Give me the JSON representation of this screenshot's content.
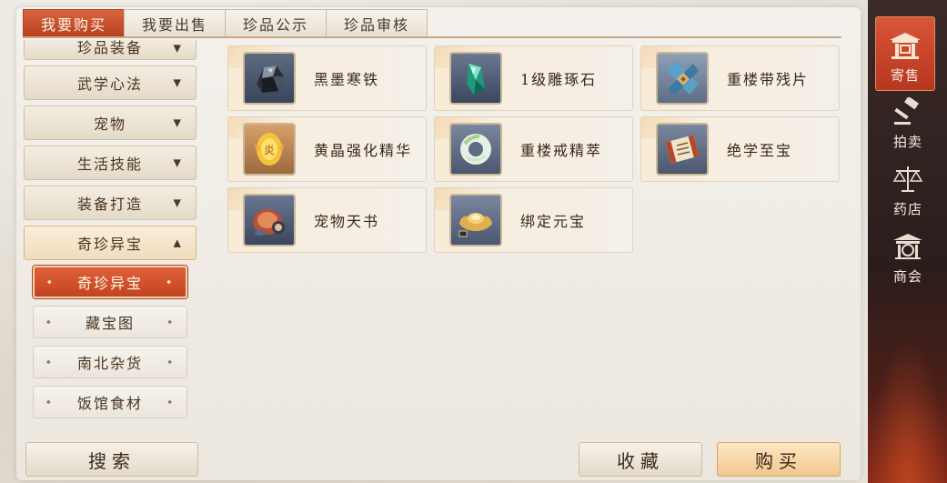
{
  "tabs": [
    {
      "label": "我要购买",
      "active": true
    },
    {
      "label": "我要出售",
      "active": false
    },
    {
      "label": "珍品公示",
      "active": false
    },
    {
      "label": "珍品审核",
      "active": false
    }
  ],
  "sidebar": {
    "categories": [
      {
        "label": "珍品装备",
        "partial": true
      },
      {
        "label": "武学心法"
      },
      {
        "label": "宠物"
      },
      {
        "label": "生活技能"
      },
      {
        "label": "装备打造"
      },
      {
        "label": "奇珍异宝",
        "open": true
      }
    ],
    "subcategories": [
      {
        "label": "奇珍异宝",
        "active": true
      },
      {
        "label": "藏宝图"
      },
      {
        "label": "南北杂货"
      },
      {
        "label": "饭馆食材"
      }
    ],
    "search_label": "搜索"
  },
  "items": [
    {
      "name": "黑墨寒铁",
      "icon": "black-iron-ore-icon"
    },
    {
      "name": "1级雕琢石",
      "icon": "green-crystal-icon"
    },
    {
      "name": "重楼带残片",
      "icon": "belt-fragment-icon"
    },
    {
      "name": "黄晶强化精华",
      "icon": "golden-essence-icon"
    },
    {
      "name": "重楼戒精萃",
      "icon": "jade-ring-icon"
    },
    {
      "name": "绝学至宝",
      "icon": "scroll-icon"
    },
    {
      "name": "宠物天书",
      "icon": "pet-book-icon"
    },
    {
      "name": "绑定元宝",
      "icon": "gold-ingot-icon"
    }
  ],
  "actions": {
    "favorite_label": "收藏",
    "buy_label": "购买"
  },
  "rightnav": [
    {
      "label": "寄售",
      "icon": "pavilion-icon",
      "active": true
    },
    {
      "label": "拍卖",
      "icon": "gavel-icon"
    },
    {
      "label": "药店",
      "icon": "scales-icon"
    },
    {
      "label": "商会",
      "icon": "guild-hall-icon"
    }
  ],
  "colors": {
    "accent": "#c8482a",
    "buy": "#f1c88f",
    "nav_bg": "#2a1d1c"
  }
}
